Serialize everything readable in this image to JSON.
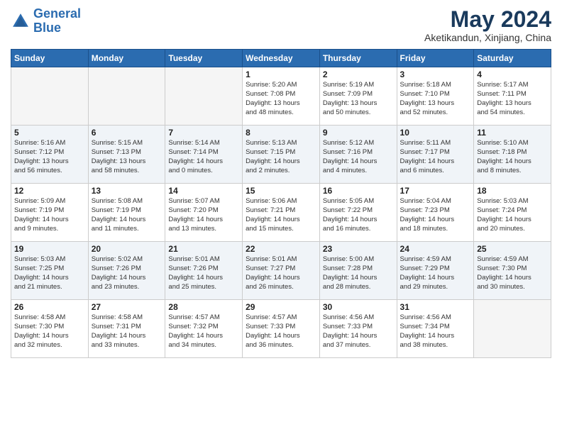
{
  "header": {
    "logo_line1": "General",
    "logo_line2": "Blue",
    "month": "May 2024",
    "location": "Aketikandun, Xinjiang, China"
  },
  "weekdays": [
    "Sunday",
    "Monday",
    "Tuesday",
    "Wednesday",
    "Thursday",
    "Friday",
    "Saturday"
  ],
  "weeks": [
    {
      "shaded": false,
      "days": [
        {
          "num": "",
          "info": ""
        },
        {
          "num": "",
          "info": ""
        },
        {
          "num": "",
          "info": ""
        },
        {
          "num": "1",
          "info": "Sunrise: 5:20 AM\nSunset: 7:08 PM\nDaylight: 13 hours\nand 48 minutes."
        },
        {
          "num": "2",
          "info": "Sunrise: 5:19 AM\nSunset: 7:09 PM\nDaylight: 13 hours\nand 50 minutes."
        },
        {
          "num": "3",
          "info": "Sunrise: 5:18 AM\nSunset: 7:10 PM\nDaylight: 13 hours\nand 52 minutes."
        },
        {
          "num": "4",
          "info": "Sunrise: 5:17 AM\nSunset: 7:11 PM\nDaylight: 13 hours\nand 54 minutes."
        }
      ]
    },
    {
      "shaded": true,
      "days": [
        {
          "num": "5",
          "info": "Sunrise: 5:16 AM\nSunset: 7:12 PM\nDaylight: 13 hours\nand 56 minutes."
        },
        {
          "num": "6",
          "info": "Sunrise: 5:15 AM\nSunset: 7:13 PM\nDaylight: 13 hours\nand 58 minutes."
        },
        {
          "num": "7",
          "info": "Sunrise: 5:14 AM\nSunset: 7:14 PM\nDaylight: 14 hours\nand 0 minutes."
        },
        {
          "num": "8",
          "info": "Sunrise: 5:13 AM\nSunset: 7:15 PM\nDaylight: 14 hours\nand 2 minutes."
        },
        {
          "num": "9",
          "info": "Sunrise: 5:12 AM\nSunset: 7:16 PM\nDaylight: 14 hours\nand 4 minutes."
        },
        {
          "num": "10",
          "info": "Sunrise: 5:11 AM\nSunset: 7:17 PM\nDaylight: 14 hours\nand 6 minutes."
        },
        {
          "num": "11",
          "info": "Sunrise: 5:10 AM\nSunset: 7:18 PM\nDaylight: 14 hours\nand 8 minutes."
        }
      ]
    },
    {
      "shaded": false,
      "days": [
        {
          "num": "12",
          "info": "Sunrise: 5:09 AM\nSunset: 7:19 PM\nDaylight: 14 hours\nand 9 minutes."
        },
        {
          "num": "13",
          "info": "Sunrise: 5:08 AM\nSunset: 7:19 PM\nDaylight: 14 hours\nand 11 minutes."
        },
        {
          "num": "14",
          "info": "Sunrise: 5:07 AM\nSunset: 7:20 PM\nDaylight: 14 hours\nand 13 minutes."
        },
        {
          "num": "15",
          "info": "Sunrise: 5:06 AM\nSunset: 7:21 PM\nDaylight: 14 hours\nand 15 minutes."
        },
        {
          "num": "16",
          "info": "Sunrise: 5:05 AM\nSunset: 7:22 PM\nDaylight: 14 hours\nand 16 minutes."
        },
        {
          "num": "17",
          "info": "Sunrise: 5:04 AM\nSunset: 7:23 PM\nDaylight: 14 hours\nand 18 minutes."
        },
        {
          "num": "18",
          "info": "Sunrise: 5:03 AM\nSunset: 7:24 PM\nDaylight: 14 hours\nand 20 minutes."
        }
      ]
    },
    {
      "shaded": true,
      "days": [
        {
          "num": "19",
          "info": "Sunrise: 5:03 AM\nSunset: 7:25 PM\nDaylight: 14 hours\nand 21 minutes."
        },
        {
          "num": "20",
          "info": "Sunrise: 5:02 AM\nSunset: 7:26 PM\nDaylight: 14 hours\nand 23 minutes."
        },
        {
          "num": "21",
          "info": "Sunrise: 5:01 AM\nSunset: 7:26 PM\nDaylight: 14 hours\nand 25 minutes."
        },
        {
          "num": "22",
          "info": "Sunrise: 5:01 AM\nSunset: 7:27 PM\nDaylight: 14 hours\nand 26 minutes."
        },
        {
          "num": "23",
          "info": "Sunrise: 5:00 AM\nSunset: 7:28 PM\nDaylight: 14 hours\nand 28 minutes."
        },
        {
          "num": "24",
          "info": "Sunrise: 4:59 AM\nSunset: 7:29 PM\nDaylight: 14 hours\nand 29 minutes."
        },
        {
          "num": "25",
          "info": "Sunrise: 4:59 AM\nSunset: 7:30 PM\nDaylight: 14 hours\nand 30 minutes."
        }
      ]
    },
    {
      "shaded": false,
      "days": [
        {
          "num": "26",
          "info": "Sunrise: 4:58 AM\nSunset: 7:30 PM\nDaylight: 14 hours\nand 32 minutes."
        },
        {
          "num": "27",
          "info": "Sunrise: 4:58 AM\nSunset: 7:31 PM\nDaylight: 14 hours\nand 33 minutes."
        },
        {
          "num": "28",
          "info": "Sunrise: 4:57 AM\nSunset: 7:32 PM\nDaylight: 14 hours\nand 34 minutes."
        },
        {
          "num": "29",
          "info": "Sunrise: 4:57 AM\nSunset: 7:33 PM\nDaylight: 14 hours\nand 36 minutes."
        },
        {
          "num": "30",
          "info": "Sunrise: 4:56 AM\nSunset: 7:33 PM\nDaylight: 14 hours\nand 37 minutes."
        },
        {
          "num": "31",
          "info": "Sunrise: 4:56 AM\nSunset: 7:34 PM\nDaylight: 14 hours\nand 38 minutes."
        },
        {
          "num": "",
          "info": ""
        }
      ]
    }
  ]
}
